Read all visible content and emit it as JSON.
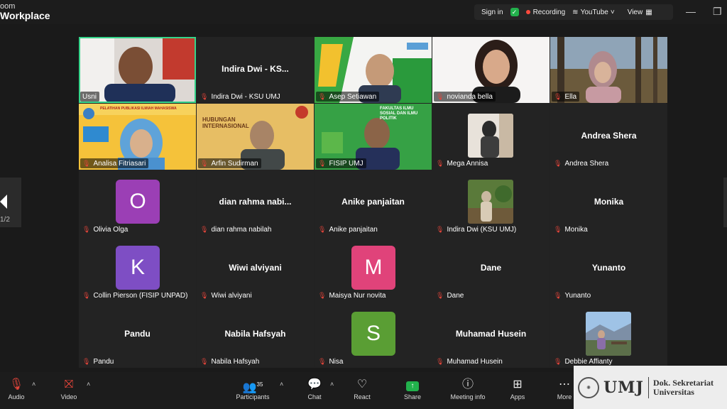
{
  "app": {
    "brand_line1": "oom",
    "brand_line2": "Workplace"
  },
  "topbar": {
    "sign_in": "Sign in",
    "recording": "Recording",
    "youtube": "YouTube",
    "view": "View",
    "accent_green": "#22b14c",
    "record_red": "#ff4a3d"
  },
  "gallery": {
    "page_indicator": "1/2",
    "tiles": [
      {
        "label": "Usni",
        "type": "video",
        "active": true
      },
      {
        "label": "Indira Dwi - KSU UMJ",
        "center": "Indira Dwi - KS...",
        "type": "name"
      },
      {
        "label": "Asep Setiawan",
        "type": "video"
      },
      {
        "label": "novianda bella",
        "type": "video"
      },
      {
        "label": "Ella",
        "type": "video"
      },
      {
        "label": "Analisa Fitriasari",
        "type": "video",
        "banner": "PELATIHAN PUBLIKASI ILMIAH MAHASISWA"
      },
      {
        "label": "Arfin Sudirman",
        "type": "video",
        "banner": "HUBUNGAN INTERNASIONAL"
      },
      {
        "label": "FISIP UMJ",
        "type": "video",
        "banner": "FAKULTAS ILMU SOSIAL DAN ILMU POLITIK"
      },
      {
        "label": "Mega Annisa",
        "type": "photo"
      },
      {
        "label": "Andrea Shera",
        "center": "Andrea Shera",
        "type": "name"
      },
      {
        "label": "Olivia Olga",
        "letter": "O",
        "color": "#9b3fb5",
        "type": "letter"
      },
      {
        "label": "dian rahma nabilah",
        "center": "dian  rahma  nabi...",
        "type": "name"
      },
      {
        "label": "Anike panjaitan",
        "center": "Anike panjaitan",
        "type": "name"
      },
      {
        "label": "Indira Dwi (KSU UMJ)",
        "type": "photo"
      },
      {
        "label": "Monika",
        "center": "Monika",
        "type": "name"
      },
      {
        "label": "Collin Pierson (FISIP UNPAD)",
        "letter": "K",
        "color": "#7e4ec4",
        "type": "letter"
      },
      {
        "label": "Wiwi alviyani",
        "center": "Wiwi alviyani",
        "type": "name"
      },
      {
        "label": "Maisya Nur novita",
        "letter": "M",
        "color": "#e0437a",
        "type": "letter"
      },
      {
        "label": "Dane",
        "center": "Dane",
        "type": "name"
      },
      {
        "label": "Yunanto",
        "center": "Yunanto",
        "type": "name"
      },
      {
        "label": "Pandu",
        "center": "Pandu",
        "type": "name"
      },
      {
        "label": "Nabila Hafsyah",
        "center": "Nabila Hafsyah",
        "type": "name"
      },
      {
        "label": "Nisa",
        "letter": "S",
        "color": "#5a9e34",
        "type": "letter"
      },
      {
        "label": "Muhamad Husein",
        "center": "Muhamad Husein",
        "type": "name"
      },
      {
        "label": "Debbie Affianty",
        "type": "photo"
      }
    ]
  },
  "toolbar": {
    "audio": "Audio",
    "video": "Video",
    "participants": "Participants",
    "participants_count": "35",
    "chat": "Chat",
    "react": "React",
    "share": "Share",
    "meeting_info": "Meeting info",
    "apps": "Apps",
    "more": "More"
  },
  "watermark": {
    "logo": "UMJ",
    "line1": "Dok. Sekretariat",
    "line2": "Universitas"
  }
}
